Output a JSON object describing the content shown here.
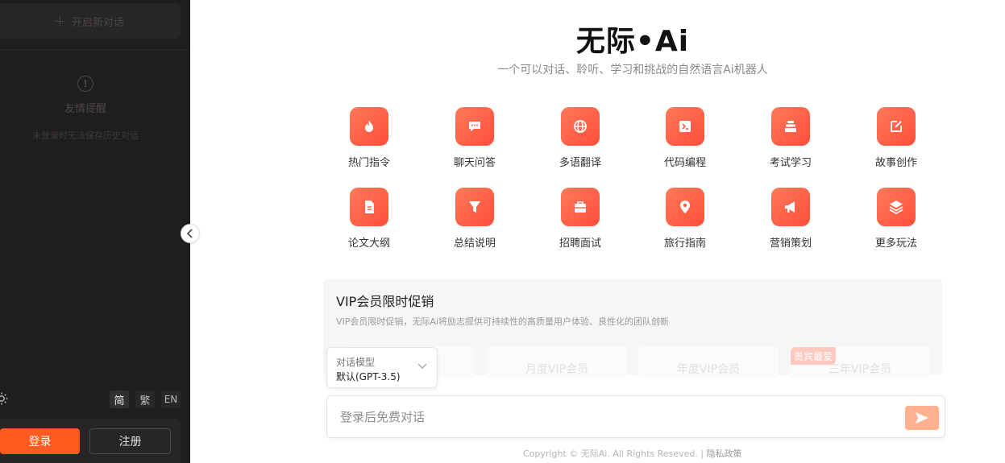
{
  "sidebar": {
    "new_chat_label": "开启新对话",
    "tip_title": "友情提醒",
    "tip_desc": "未登录时无法保存历史对话",
    "lang_simplified": "简",
    "lang_traditional": "繁",
    "lang_en": "EN",
    "login_label": "登录",
    "register_label": "注册"
  },
  "brand": {
    "title": "无际•Ai",
    "subtitle": "一个可以对话、聆听、学习和挑战的自然语言Ai机器人"
  },
  "features": [
    {
      "label": "热门指令",
      "icon": "fire-icon"
    },
    {
      "label": "聊天问答",
      "icon": "chat-bubble-icon"
    },
    {
      "label": "多语翻译",
      "icon": "globe-icon"
    },
    {
      "label": "代码编程",
      "icon": "terminal-icon"
    },
    {
      "label": "考试学习",
      "icon": "stack-icon"
    },
    {
      "label": "故事创作",
      "icon": "edit-icon"
    },
    {
      "label": "论文大纲",
      "icon": "document-icon"
    },
    {
      "label": "总结说明",
      "icon": "filter-icon"
    },
    {
      "label": "招聘面试",
      "icon": "briefcase-icon"
    },
    {
      "label": "旅行指南",
      "icon": "location-pin-icon"
    },
    {
      "label": "营销策划",
      "icon": "megaphone-icon"
    },
    {
      "label": "更多玩法",
      "icon": "layers-icon"
    }
  ],
  "vip": {
    "title": "VIP会员限时促销",
    "desc": "VIP会员限时促销，无际Ai将励志提供可持续性的高质量用户体验、良性化的团队创新",
    "plans": [
      "月度VIP会员",
      "年度VIP会员",
      "三年VIP会员"
    ],
    "badge": "贵宾最爱"
  },
  "model_select": {
    "label": "对话模型",
    "value": "默认(GPT-3.5)"
  },
  "chat": {
    "placeholder": "登录后免费对话"
  },
  "footer": {
    "copyright": "Copyright © 无际Ai. All Rights Reseved. | ",
    "privacy": "隐私政策"
  },
  "colors": {
    "accent": "#ff5a1f",
    "icon_gradient_start": "#ff7a59",
    "icon_gradient_end": "#ff4e3a",
    "sidebar_bg": "#201e1d"
  }
}
